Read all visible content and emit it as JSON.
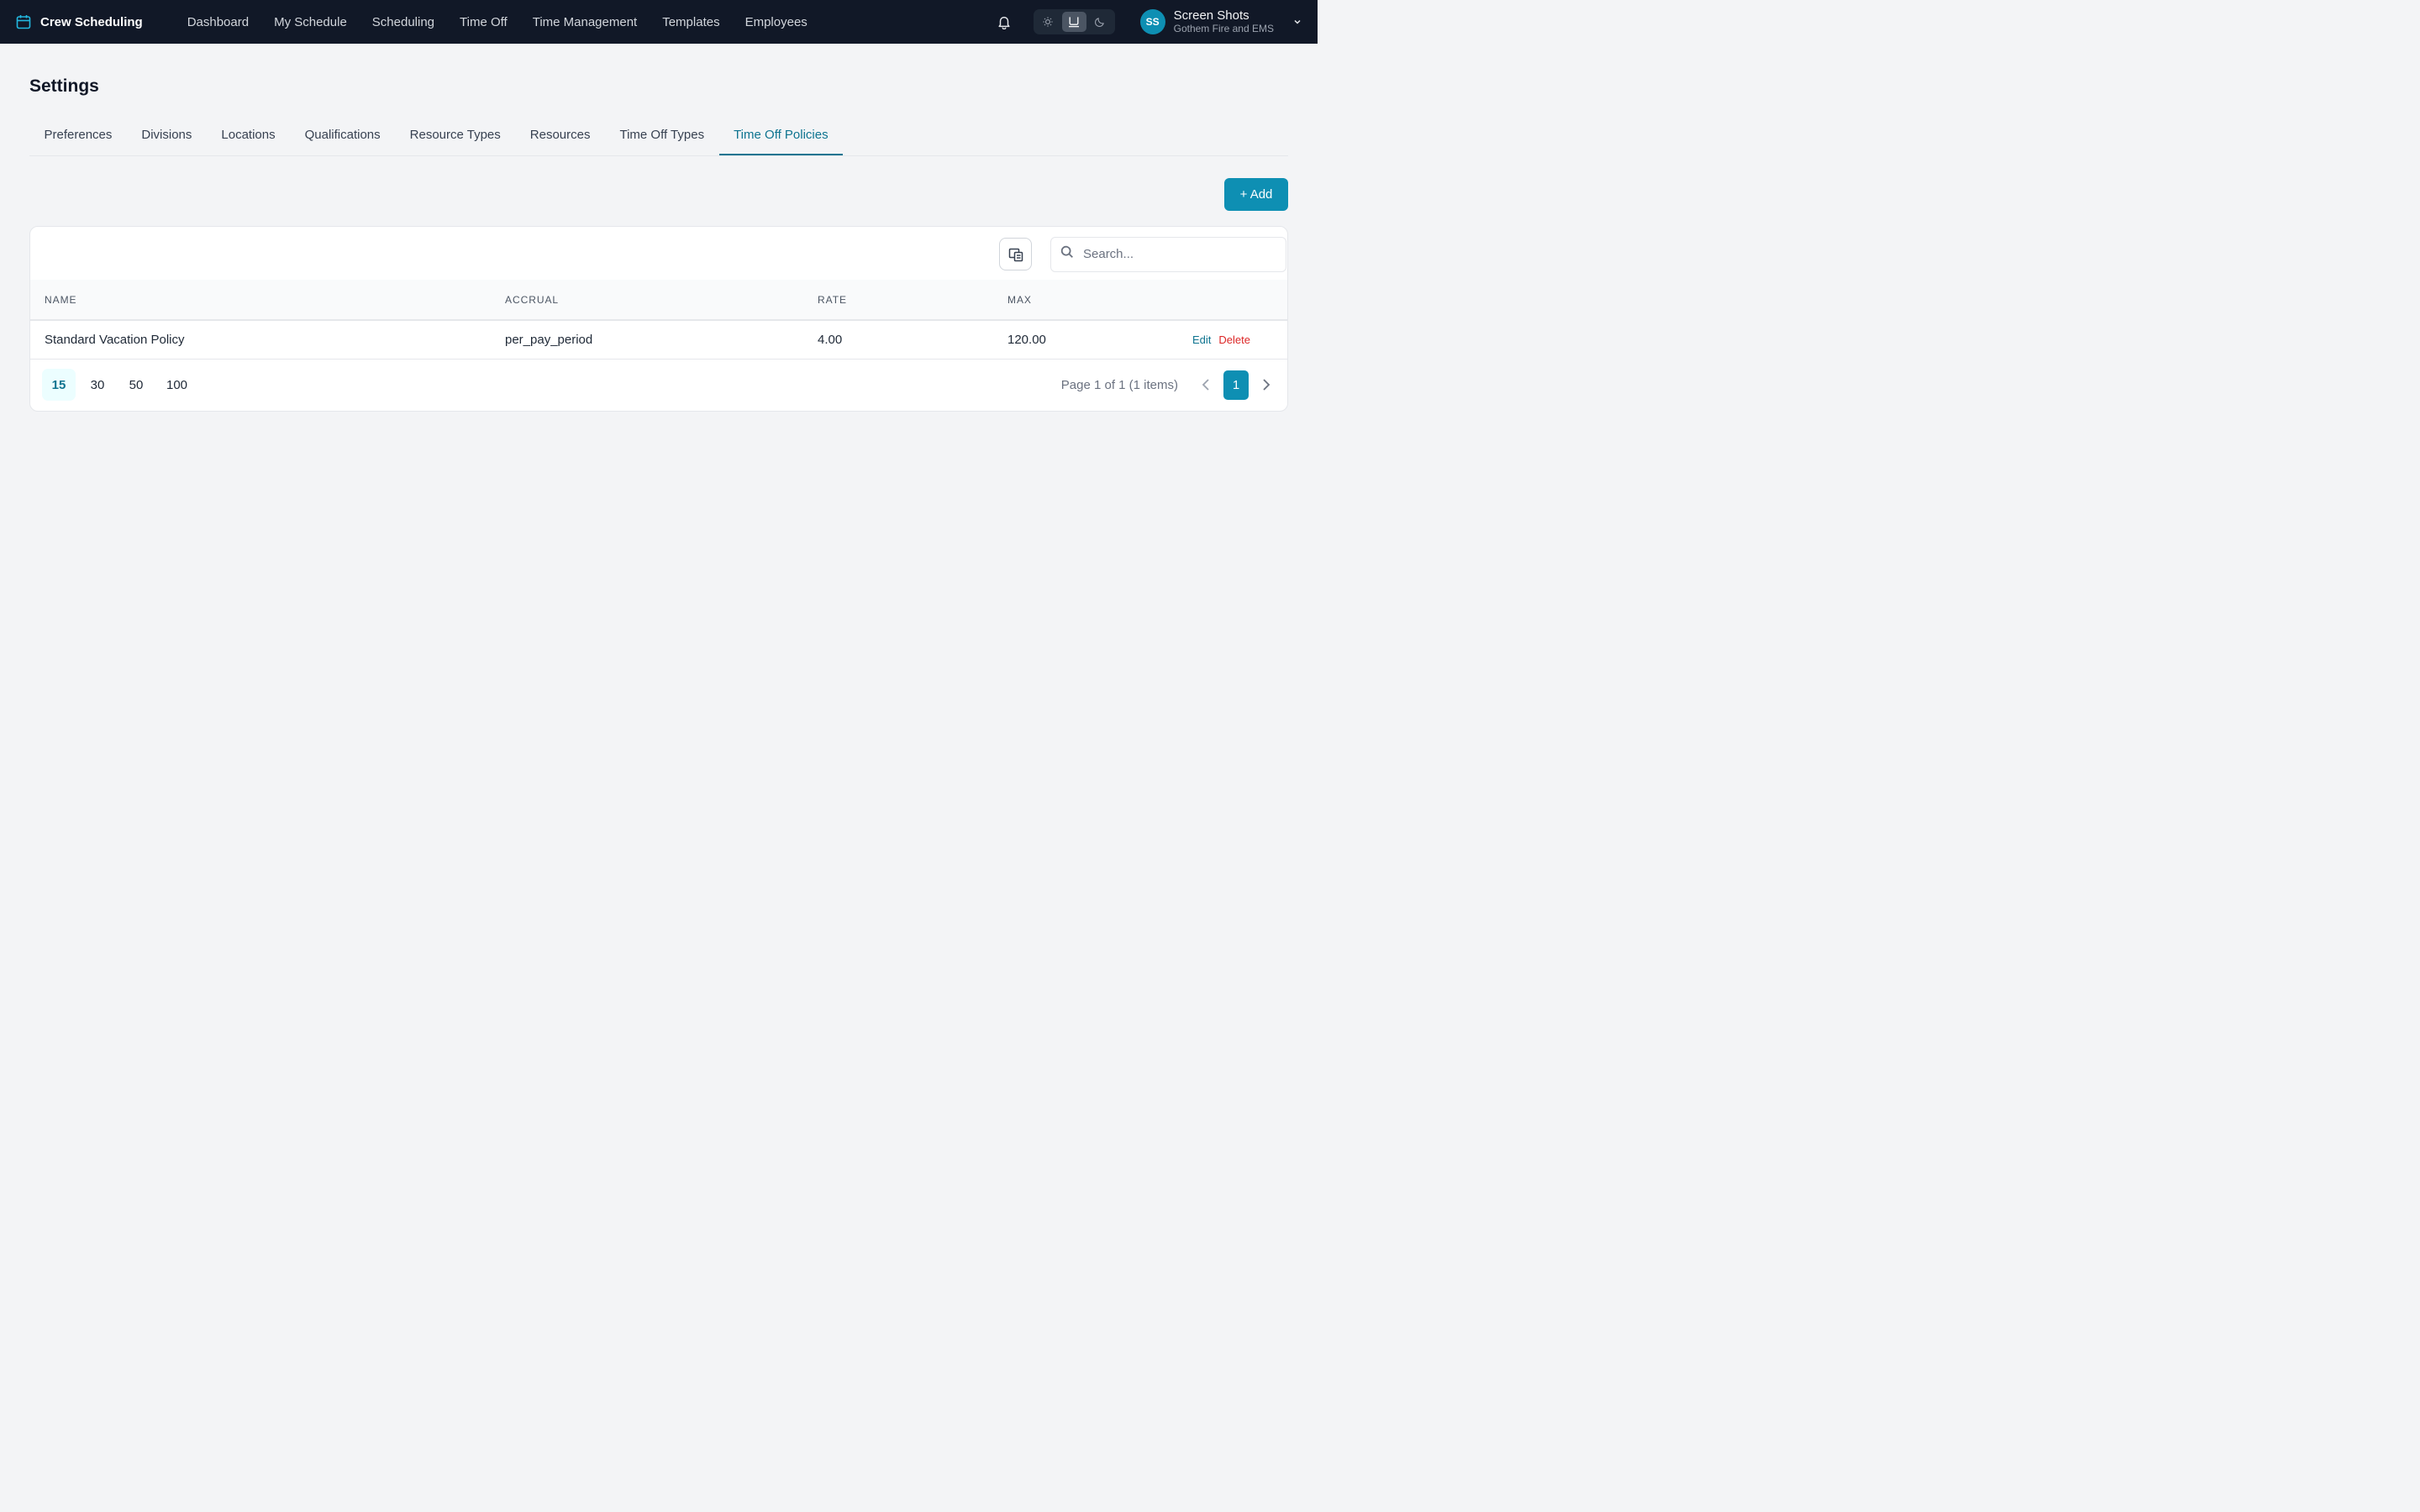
{
  "app": {
    "name": "Crew Scheduling",
    "icon": "calendar-icon"
  },
  "nav": {
    "items": [
      {
        "label": "Dashboard"
      },
      {
        "label": "My Schedule"
      },
      {
        "label": "Scheduling"
      },
      {
        "label": "Time Off"
      },
      {
        "label": "Time Management"
      },
      {
        "label": "Templates"
      },
      {
        "label": "Employees"
      }
    ],
    "theme_options": [
      "sun-icon",
      "monitor-icon",
      "moon-icon"
    ],
    "theme_selected": "monitor-icon"
  },
  "user": {
    "initials": "SS",
    "name": "Screen Shots",
    "org": "Gothem Fire and EMS"
  },
  "page": {
    "title": "Settings"
  },
  "tabs": [
    {
      "label": "Preferences"
    },
    {
      "label": "Divisions"
    },
    {
      "label": "Locations"
    },
    {
      "label": "Qualifications"
    },
    {
      "label": "Resource Types"
    },
    {
      "label": "Resources"
    },
    {
      "label": "Time Off Types"
    },
    {
      "label": "Time Off Policies",
      "active": true
    }
  ],
  "actions": {
    "add_label": "+ Add"
  },
  "search": {
    "placeholder": "Search..."
  },
  "table": {
    "headers": {
      "name": "NAME",
      "accrual": "ACCRUAL",
      "rate": "RATE",
      "max": "MAX"
    },
    "rows": [
      {
        "name": "Standard Vacation Policy",
        "accrual": "per_pay_period",
        "rate": "4.00",
        "max": "120.00",
        "edit": "Edit",
        "delete": "Delete"
      }
    ]
  },
  "pagination": {
    "sizes": [
      "15",
      "30",
      "50",
      "100"
    ],
    "selected_size": "15",
    "info": "Page 1 of 1 (1 items)",
    "current_page": "1"
  },
  "colors": {
    "accent": "#0e8fb3",
    "nav_bg": "#111827",
    "danger": "#dc2626"
  }
}
